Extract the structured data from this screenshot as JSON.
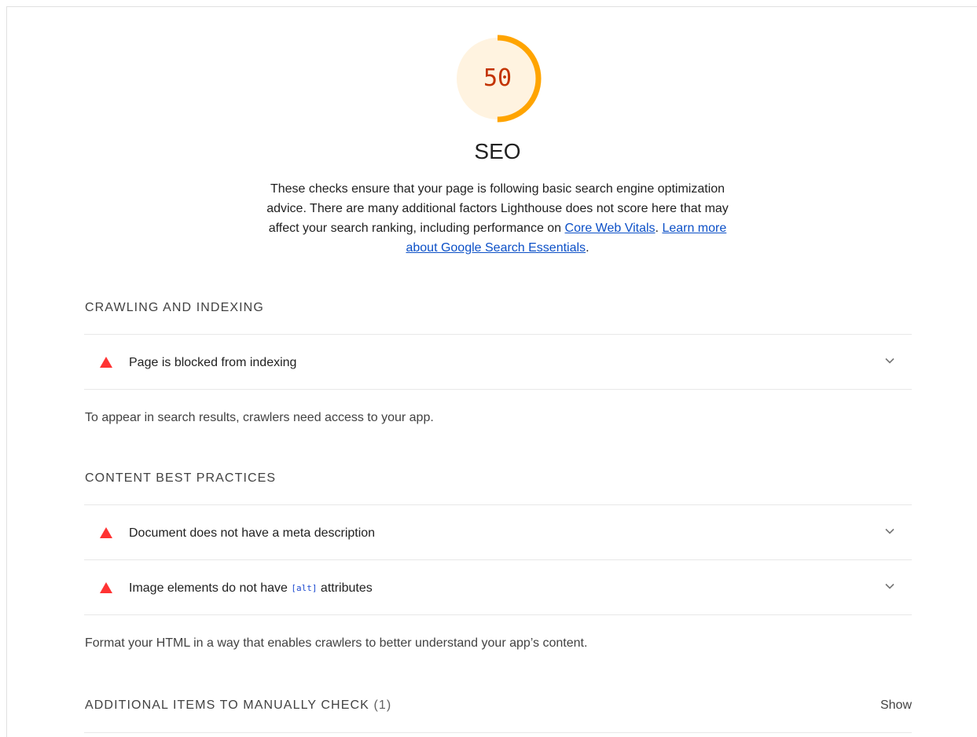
{
  "category": {
    "score": "50",
    "score_fraction": 0.5,
    "title": "SEO",
    "description_text": "These checks ensure that your page is following basic search engine optimization advice. There are many additional factors Lighthouse does not score here that may affect your search ranking, including performance on ",
    "link_core_web_vitals": "Core Web Vitals",
    "separator": ". ",
    "link_search_essentials": "Learn more about Google Search Essentials",
    "end_period": "."
  },
  "groups": {
    "crawling": {
      "title": "CRAWLING AND INDEXING",
      "audits": [
        {
          "title": "Page is blocked from indexing"
        }
      ],
      "description": "To appear in search results, crawlers need access to your app."
    },
    "content": {
      "title": "CONTENT BEST PRACTICES",
      "audits": [
        {
          "title": "Document does not have a meta description"
        },
        {
          "title_before": "Image elements do not have ",
          "code": "[alt]",
          "title_after": " attributes"
        }
      ],
      "description": "Format your HTML in a way that enables crawlers to better understand your app’s content."
    },
    "manual": {
      "title": "ADDITIONAL ITEMS TO MANUALLY CHECK",
      "count": " (1)",
      "toggle_label": "Show"
    }
  },
  "colors": {
    "gauge_arc": "#ffa400",
    "gauge_fill": "#fff3e0",
    "score_text": "#c33300",
    "fail_icon": "#ff3333",
    "link": "#0c50c7"
  },
  "icons": {
    "fail": "fail-triangle-icon",
    "expand": "chevron-down-icon"
  }
}
